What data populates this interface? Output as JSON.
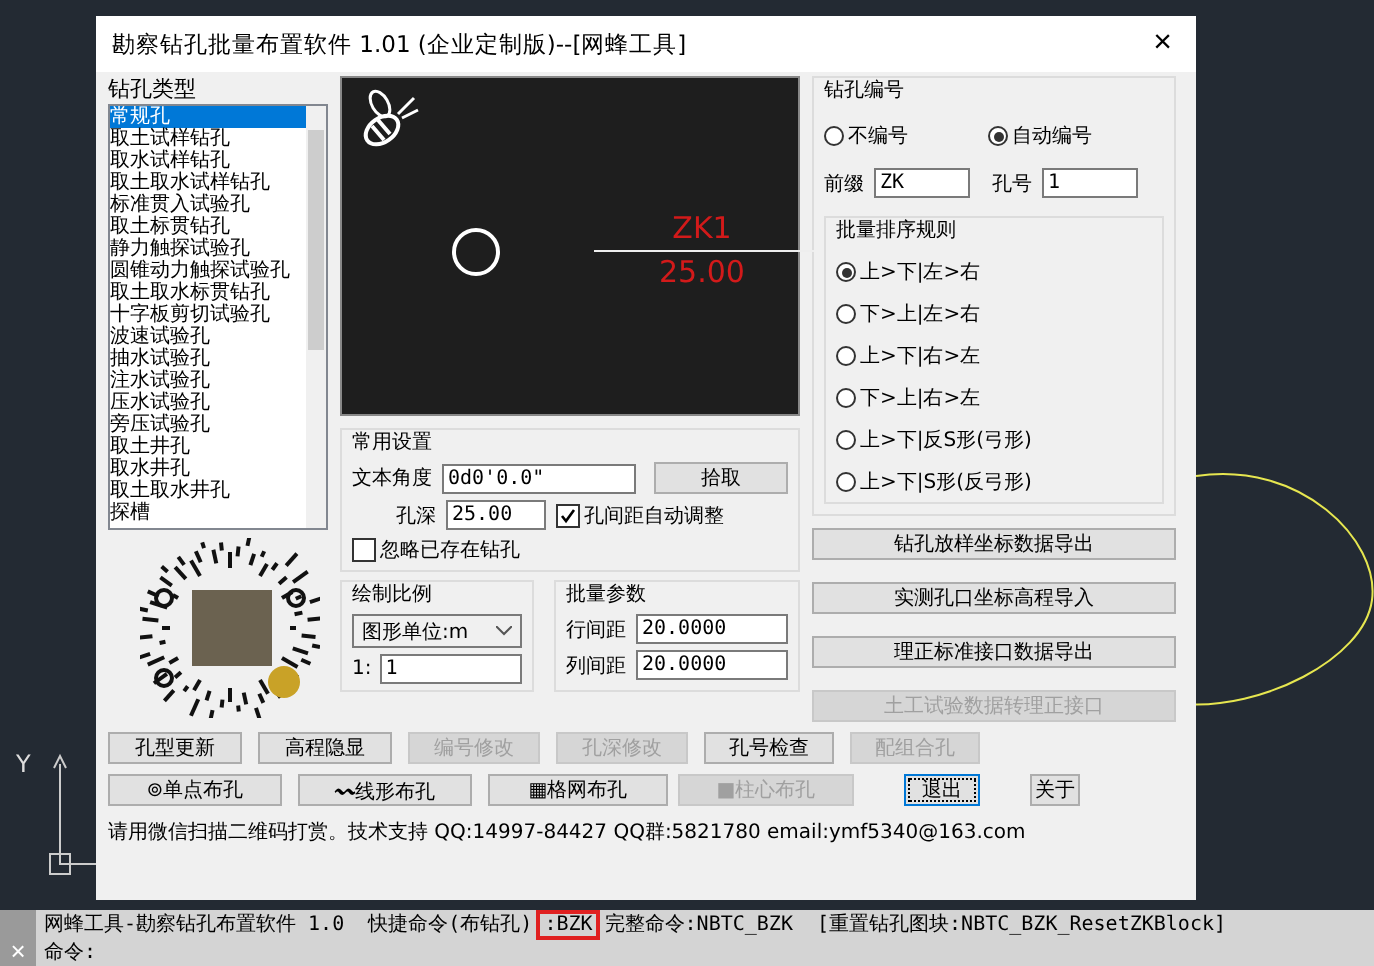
{
  "canvas": {
    "ucs_label": "Y"
  },
  "dialog": {
    "title": "勘察钻孔批量布置软件 1.01 (企业定制版)--[网蜂工具]",
    "close": "×"
  },
  "hole_types": {
    "title": "钻孔类型",
    "items": [
      {
        "label": "常规孔",
        "selected": true
      },
      {
        "label": "取土试样钻孔",
        "selected": false
      },
      {
        "label": "取水试样钻孔",
        "selected": false
      },
      {
        "label": "取土取水试样钻孔",
        "selected": false
      },
      {
        "label": "标准贯入试验孔",
        "selected": false
      },
      {
        "label": "取土标贯钻孔",
        "selected": false
      },
      {
        "label": "静力触探试验孔",
        "selected": false
      },
      {
        "label": "圆锥动力触探试验孔",
        "selected": false
      },
      {
        "label": "取土取水标贯钻孔",
        "selected": false
      },
      {
        "label": "十字板剪切试验孔",
        "selected": false
      },
      {
        "label": "波速试验孔",
        "selected": false
      },
      {
        "label": "抽水试验孔",
        "selected": false
      },
      {
        "label": "注水试验孔",
        "selected": false
      },
      {
        "label": "压水试验孔",
        "selected": false
      },
      {
        "label": "旁压试验孔",
        "selected": false
      },
      {
        "label": "取土井孔",
        "selected": false
      },
      {
        "label": "取水井孔",
        "selected": false
      },
      {
        "label": "取土取水井孔",
        "selected": false
      },
      {
        "label": "探槽",
        "selected": false
      }
    ]
  },
  "preview": {
    "hole_label": "ZK1",
    "depth_label": "25.00"
  },
  "common_settings": {
    "title": "常用设置",
    "text_angle": {
      "label": "文本角度",
      "value": "0d0'0.0\""
    },
    "pick_button": "拾取",
    "depth": {
      "label": "孔深",
      "value": "25.00"
    },
    "auto_spacing": {
      "label": "孔间距自动调整",
      "checked": true
    },
    "ignore_existing": {
      "label": "忽略已存在钻孔",
      "checked": false
    }
  },
  "draw_scale": {
    "title": "绘制比例",
    "unit_select": "图形单位:m",
    "ratio_label": "1:",
    "ratio_value": "1"
  },
  "batch_params": {
    "title": "批量参数",
    "row_spacing": {
      "label": "行间距",
      "value": "20.0000"
    },
    "col_spacing": {
      "label": "列间距",
      "value": "20.0000"
    }
  },
  "numbering": {
    "title": "钻孔编号",
    "modes": [
      {
        "label": "不编号",
        "selected": false
      },
      {
        "label": "自动编号",
        "selected": true
      }
    ],
    "prefix": {
      "label": "前缀",
      "value": "ZK"
    },
    "number": {
      "label": "孔号",
      "value": "1"
    },
    "sort_rules": {
      "title": "批量排序规则",
      "options": [
        {
          "label": "上>下|左>右",
          "selected": true
        },
        {
          "label": "下>上|左>右",
          "selected": false
        },
        {
          "label": "上>下|右>左",
          "selected": false
        },
        {
          "label": "下>上|右>左",
          "selected": false
        },
        {
          "label": "上>下|反S形(弓形)",
          "selected": false
        },
        {
          "label": "上>下|S形(反弓形)",
          "selected": false
        }
      ]
    }
  },
  "side_buttons": [
    {
      "label": "钻孔放样坐标数据导出",
      "disabled": false
    },
    {
      "label": "实测孔口坐标高程导入",
      "disabled": false
    },
    {
      "label": "理正标准接口数据导出",
      "disabled": false
    },
    {
      "label": "土工试验数据转理正接口",
      "disabled": true
    }
  ],
  "button_rows": [
    [
      {
        "label": "孔型更新",
        "disabled": false,
        "focused": false
      },
      {
        "label": "高程隐显",
        "disabled": false,
        "focused": false
      },
      {
        "label": "编号修改",
        "disabled": true,
        "focused": false
      },
      {
        "label": "孔深修改",
        "disabled": true,
        "focused": false
      },
      {
        "label": "孔号检查",
        "disabled": false,
        "focused": false
      },
      {
        "label": "配组合孔",
        "disabled": true,
        "focused": false
      }
    ],
    [
      {
        "label": "⊚单点布孔",
        "disabled": false,
        "focused": false
      },
      {
        "label": "〰线形布孔",
        "disabled": false,
        "focused": false
      },
      {
        "label": "▦格网布孔",
        "disabled": false,
        "focused": false
      },
      {
        "label": "■柱心布孔",
        "disabled": true,
        "focused": false
      },
      {
        "label": "退出",
        "disabled": false,
        "focused": true
      },
      {
        "label": "关于",
        "disabled": false,
        "focused": false
      }
    ]
  ],
  "footer": "请用微信扫描二维码打赏。技术支持 QQ:14997-84427 QQ群:5821780 email:ymf5340@163.com",
  "command_bar": {
    "close": "×",
    "lines": [
      {
        "segments": [
          {
            "text": "网蜂工具-勘察钻孔布置软件 1.0  快捷命令(布钻孔)",
            "highlighted": false
          },
          {
            "text": ":BZK",
            "highlighted": true
          },
          {
            "text": "完整命令:NBTC_BZK  [重置钻孔图块:NBTC_BZK_ResetZKBlock]",
            "highlighted": false
          }
        ]
      },
      {
        "segments": [
          {
            "text": "命令:",
            "highlighted": false
          }
        ]
      }
    ]
  }
}
